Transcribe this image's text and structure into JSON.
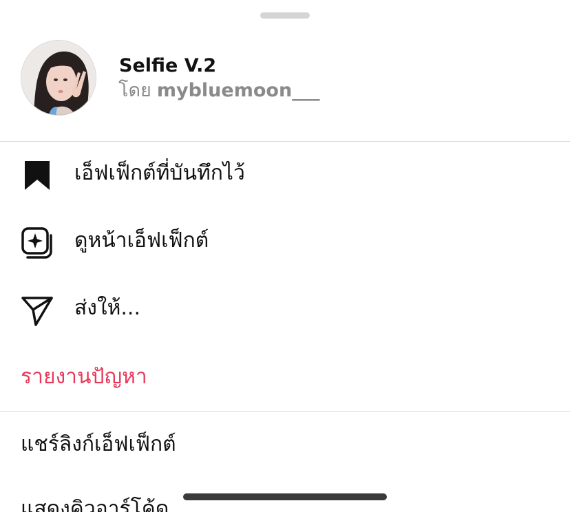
{
  "header": {
    "effect_name": "Selfie V.2",
    "by_prefix": "โดย",
    "creator": "mybluemoon___"
  },
  "menu": {
    "saved_effects": {
      "label": "เอ็ฟเฟ็กต์ที่บันทึกไว้",
      "icon": "bookmark-icon"
    },
    "view_effect_page": {
      "label": "ดูหน้าเอ็ฟเฟ็กต์",
      "icon": "effect-gallery-icon"
    },
    "send_to": {
      "label": "ส่งให้...",
      "icon": "send-icon"
    },
    "report_problem": {
      "label": "รายงานปัญหา",
      "color": "#e8395a"
    }
  },
  "secondary": {
    "share_link": "แชร์ลิงก์เอ็ฟเฟ็กต์",
    "show_qr_code": "แสดงคิวอาร์โค้ด"
  }
}
